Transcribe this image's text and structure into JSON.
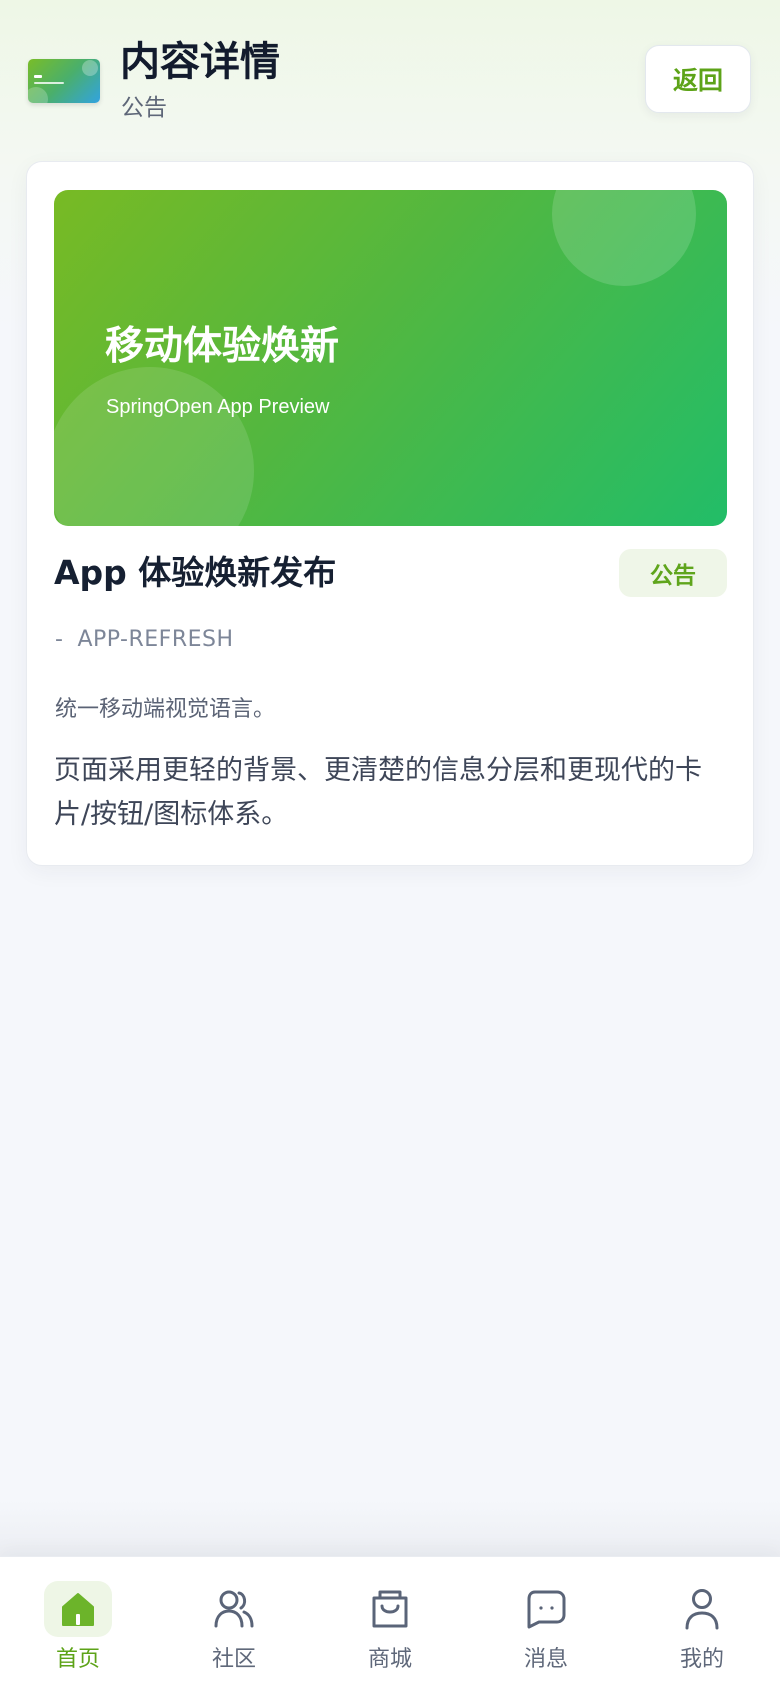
{
  "header": {
    "title": "内容详情",
    "subtitle": "公告",
    "back_label": "返回"
  },
  "hero": {
    "title": "移动体验焕新",
    "subtitle": "SpringOpen App Preview"
  },
  "article": {
    "title": "App 体验焕新发布",
    "badge": "公告",
    "meta_dash": "-",
    "slug": "APP-REFRESH",
    "summary": "统一移动端视觉语言。",
    "body": "页面采用更轻的背景、更清楚的信息分层和更现代的卡片/按钮/图标体系。"
  },
  "tabbar": {
    "items": [
      {
        "label": "首页",
        "icon": "home-icon",
        "active": true
      },
      {
        "label": "社区",
        "icon": "users-icon",
        "active": false
      },
      {
        "label": "商城",
        "icon": "shopping-bag-icon",
        "active": false
      },
      {
        "label": "消息",
        "icon": "message-icon",
        "active": false
      },
      {
        "label": "我的",
        "icon": "user-icon",
        "active": false
      }
    ]
  },
  "colors": {
    "accent": "#5da318",
    "hero_start": "#78ba24",
    "hero_end": "#22bd68",
    "title_text": "#162032",
    "muted_text": "#5f687a"
  }
}
